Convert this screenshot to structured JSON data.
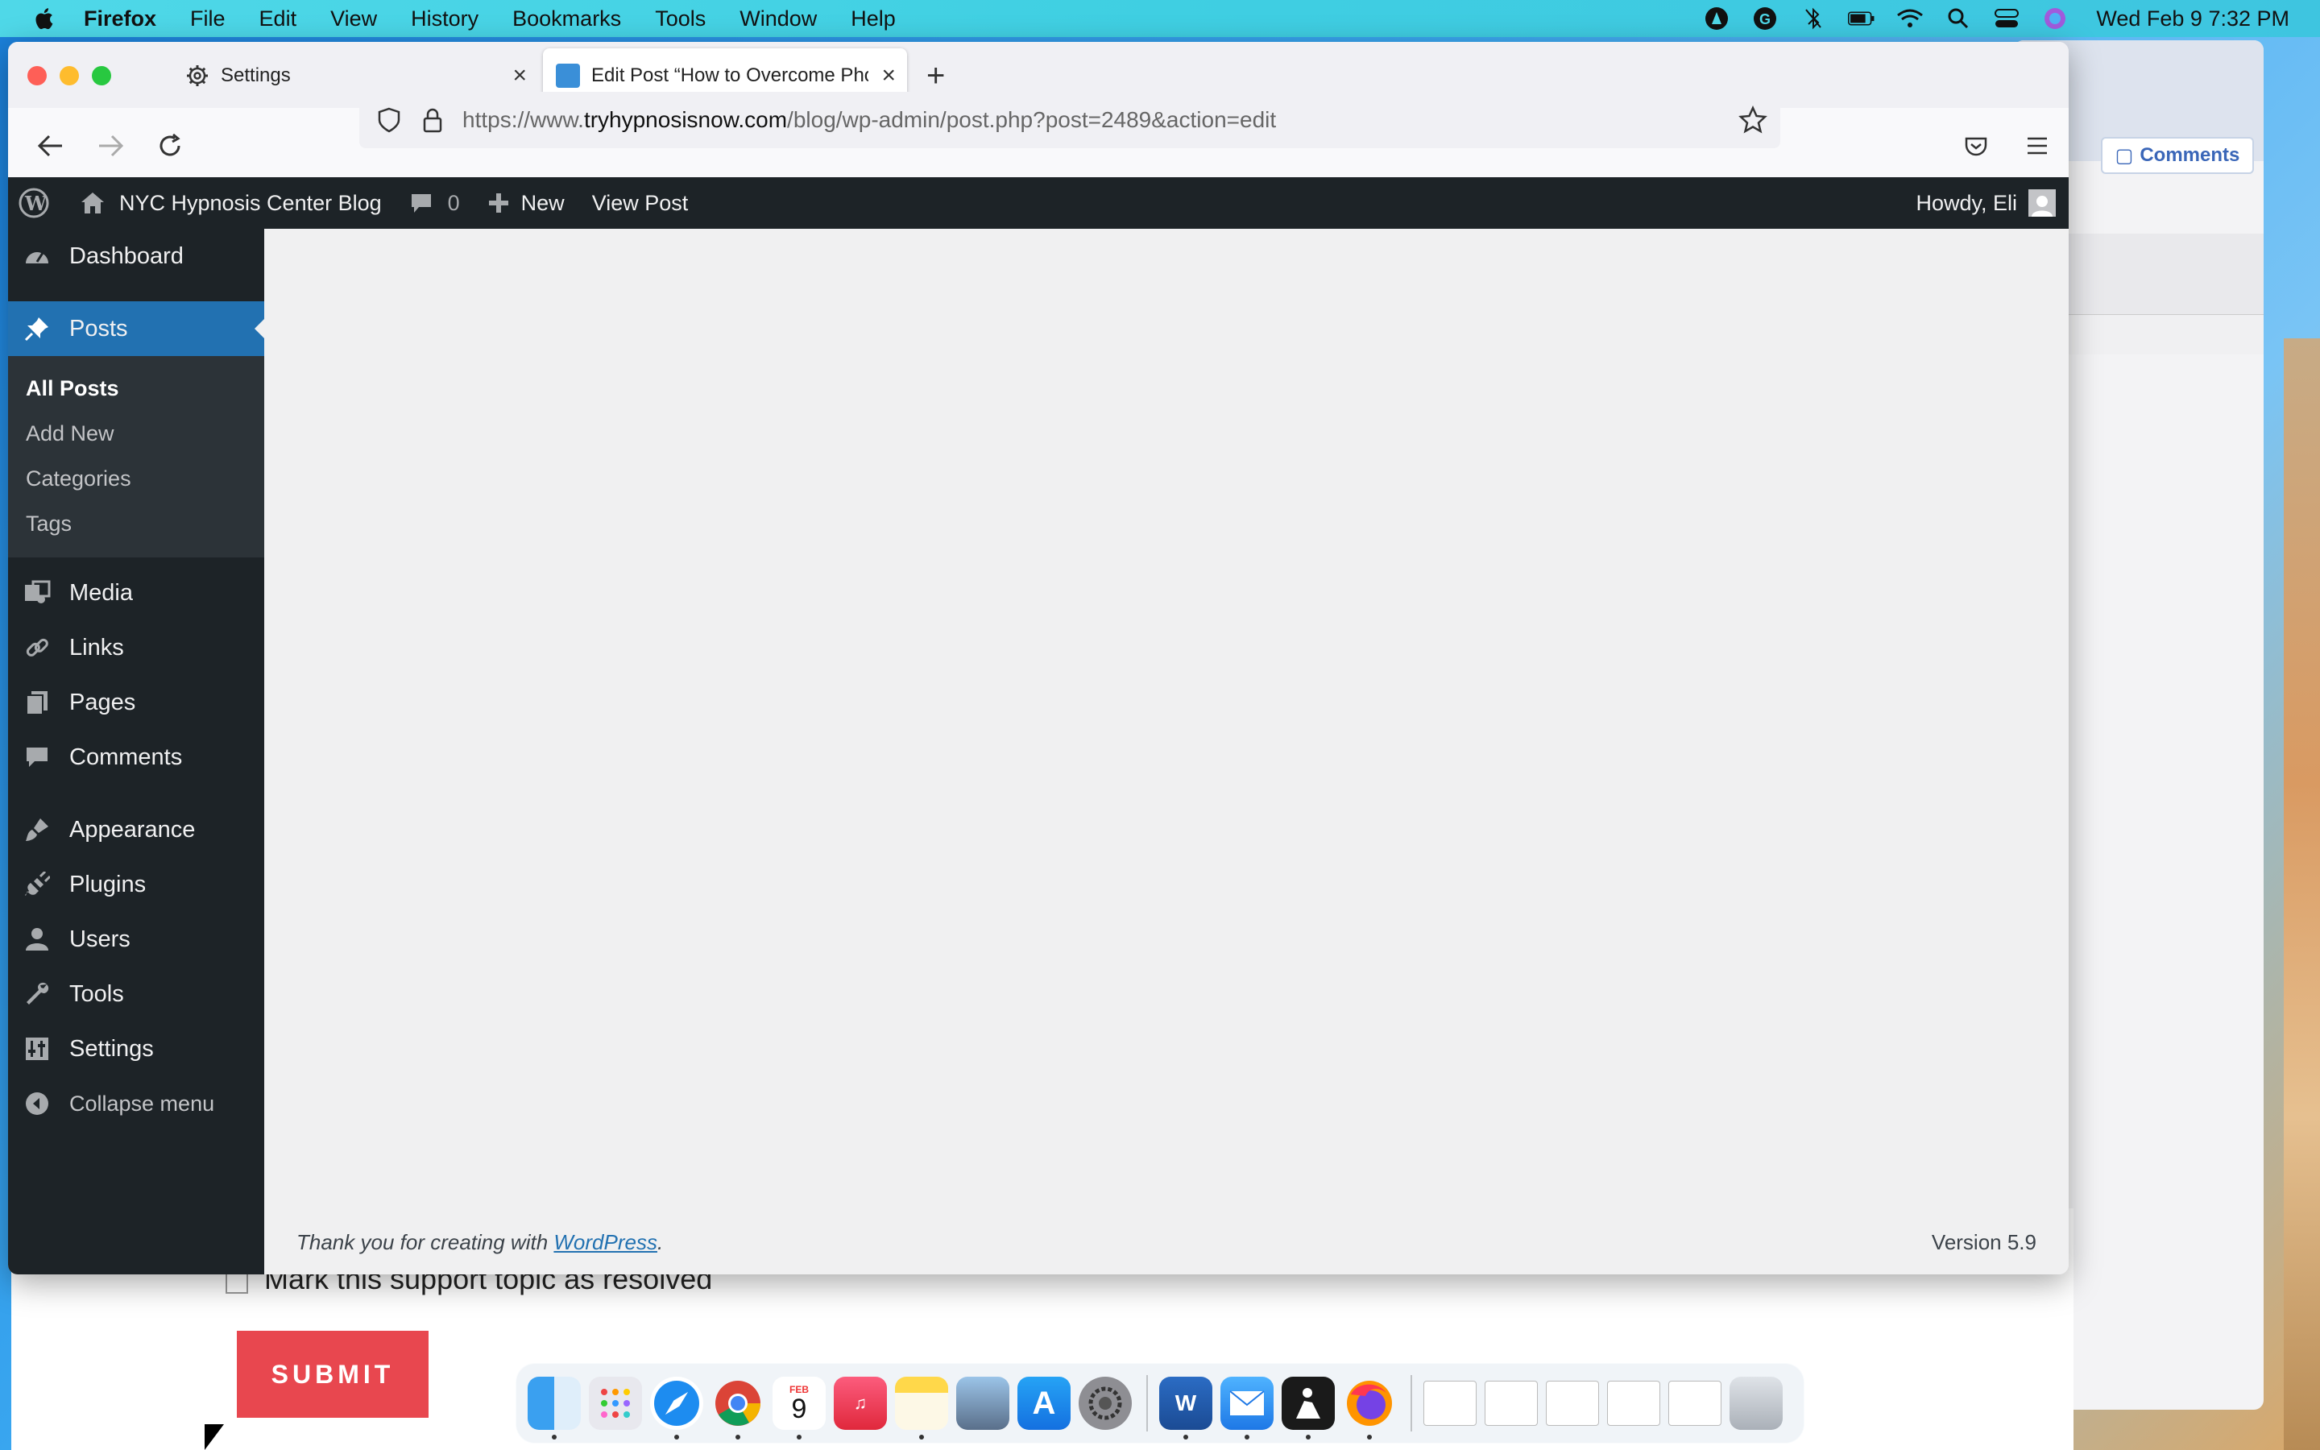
{
  "menubar": {
    "app_name": "Firefox",
    "items": [
      "File",
      "Edit",
      "View",
      "History",
      "Bookmarks",
      "Tools",
      "Window",
      "Help"
    ],
    "clock": "Wed Feb 9  7:32 PM",
    "status_icons": [
      "avast-icon",
      "grammarly-icon",
      "bluetooth-icon",
      "battery-icon",
      "wifi-icon",
      "spotlight-icon",
      "control-center-icon",
      "siri-icon"
    ]
  },
  "browser": {
    "tabs": [
      {
        "label": "Settings",
        "icon": "gear-icon"
      },
      {
        "label": "Edit Post “How to Overcome Phobias",
        "icon": "wordpress-favicon"
      }
    ],
    "url": {
      "prefix": "https://www.",
      "host": "tryhypnosisnow.com",
      "path": "/blog/wp-admin/post.php?post=2489&action=edit"
    }
  },
  "wp_adminbar": {
    "site_name": "NYC Hypnosis Center Blog",
    "comments_count": "0",
    "new_label": "New",
    "view_post_label": "View Post",
    "howdy": "Howdy, Eli"
  },
  "wp_sidebar": {
    "dashboard": "Dashboard",
    "posts": "Posts",
    "posts_submenu": [
      "All Posts",
      "Add New",
      "Categories",
      "Tags"
    ],
    "media": "Media",
    "links": "Links",
    "pages": "Pages",
    "comments": "Comments",
    "appearance": "Appearance",
    "plugins": "Plugins",
    "users": "Users",
    "tools": "Tools",
    "settings": "Settings",
    "collapse": "Collapse menu"
  },
  "wp_footer": {
    "thanks_prefix": "Thank you for creating with ",
    "wordpress_link": "WordPress",
    "thanks_suffix": ".",
    "version": "Version 5.9"
  },
  "background": {
    "comments_button": "Comments",
    "resolved_label": "Mark this support topic as resolved",
    "submit_label": "SUBMIT"
  },
  "dock": {
    "apps": [
      "Finder",
      "Launchpad",
      "Safari",
      "Chrome",
      "Calendar",
      "Music",
      "Notes",
      "Preview",
      "App Store",
      "System Preferences",
      "Word",
      "Mail",
      "Kindle",
      "Firefox"
    ],
    "calendar_month": "FEB",
    "calendar_day": "9"
  },
  "colors": {
    "wp_dark": "#1d2327",
    "wp_accent": "#2271b1",
    "submit_red": "#e8474f"
  }
}
